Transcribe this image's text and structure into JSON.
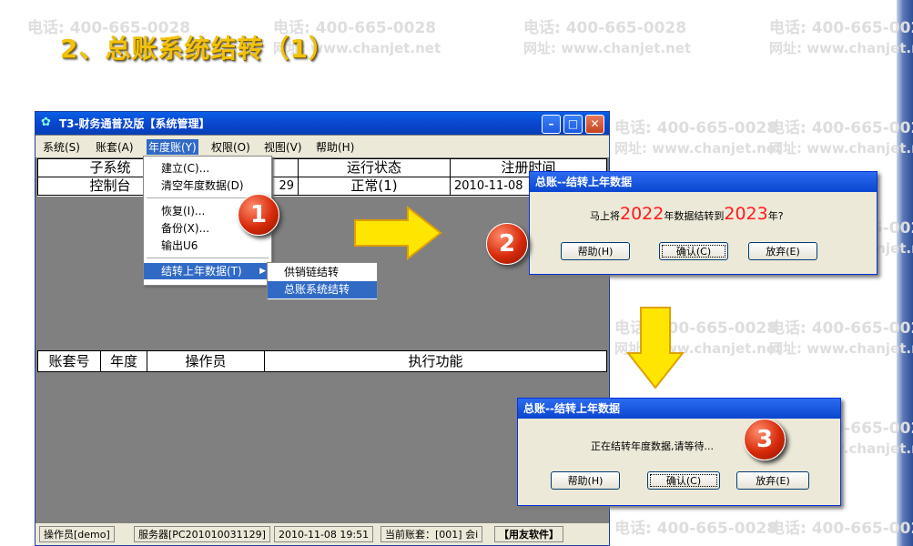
{
  "slide": {
    "title": "2、总账系统结转（1）"
  },
  "watermark": {
    "phone": "电话: 400-665-0028",
    "site": "网址: www.chanjet.net"
  },
  "window": {
    "title": "T3-财务通普及版【系统管理】",
    "menu": [
      "系统(S)",
      "账套(A)",
      "年度账(Y)",
      "权限(O)",
      "视图(V)",
      "帮助(H)"
    ],
    "top_headers": [
      "子系统",
      "运行状态",
      "注册时间"
    ],
    "top_row": [
      "控制台",
      "29",
      "正常(1)",
      "2010-11-08"
    ],
    "mid_headers": [
      "账套号",
      "年度",
      "操作员",
      "执行功能"
    ],
    "status": [
      "操作员[demo]",
      "服务器[PC201010031129]",
      "2010-11-08 19:51",
      "当前账套：[001] 会i",
      "【用友软件】"
    ]
  },
  "dropdown": {
    "items": [
      "建立(C)...",
      "清空年度数据(D)",
      "恢复(I)...",
      "备份(X)...",
      "输出U6",
      "结转上年数据(T)"
    ],
    "submenu": [
      "供销链结转",
      "总账系统结转"
    ]
  },
  "badges": [
    "1",
    "2",
    "3"
  ],
  "dialog1": {
    "title": "总账--结转上年数据",
    "text_a": "马上将",
    "year_from": "2022",
    "text_b": "年数据结转到",
    "year_to": "2023",
    "text_c": "年?",
    "buttons": [
      "帮助(H)",
      "确认(C)",
      "放弃(E)"
    ]
  },
  "dialog2": {
    "title": "总账--结转上年数据",
    "text": "正在结转年度数据,请等待...",
    "buttons": [
      "帮助(H)",
      "确认(C)",
      "放弃(E)"
    ]
  },
  "colors": {
    "accent_title": "#f2c10a",
    "badge": "#d62a0a",
    "arrow": "#ffe600",
    "year": "#ff1a1a"
  }
}
